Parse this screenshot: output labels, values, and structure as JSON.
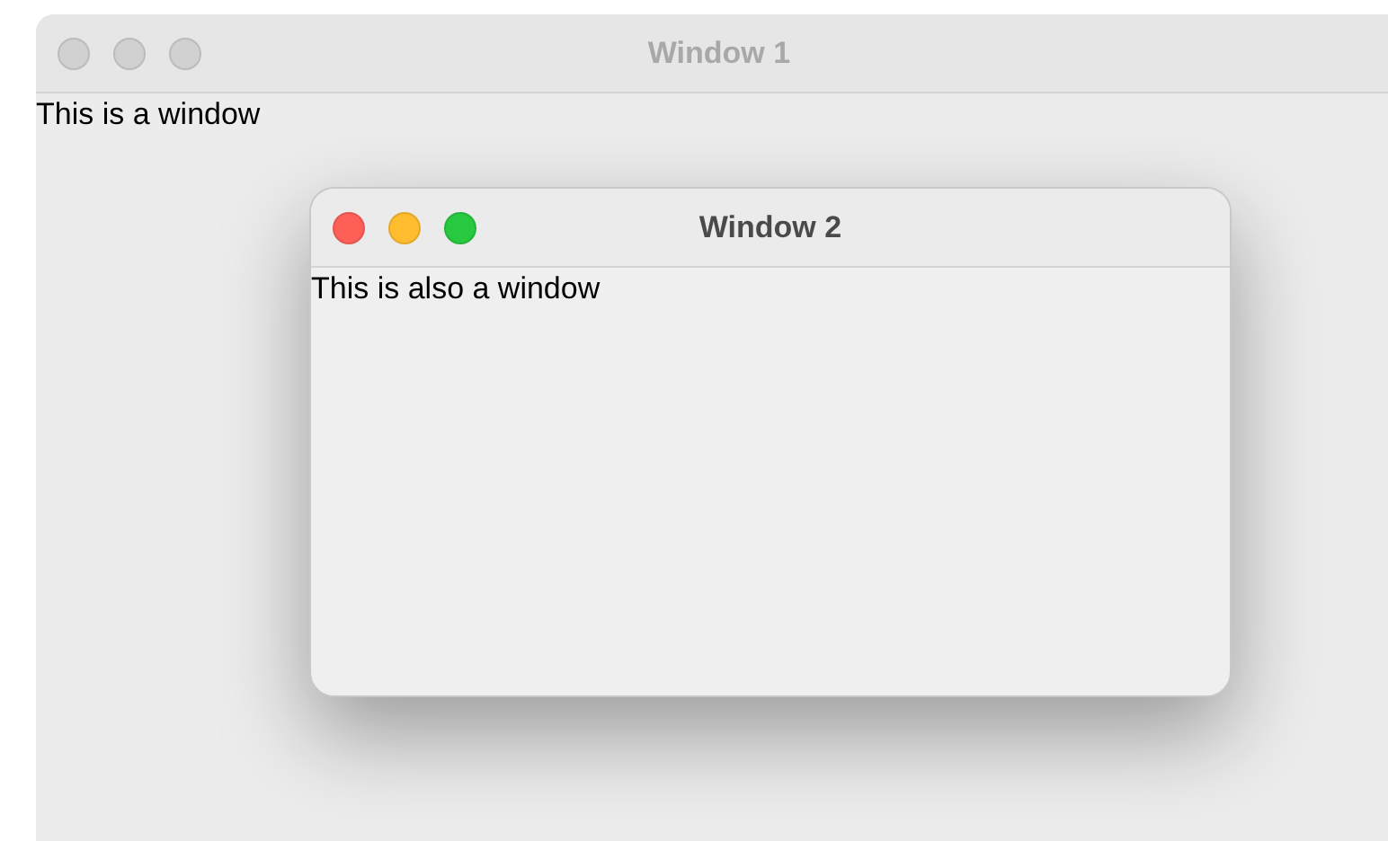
{
  "windows": [
    {
      "title": "Window 1",
      "text": "This is a window",
      "active": false
    },
    {
      "title": "Window 2",
      "text": "This is also a window",
      "active": true
    }
  ]
}
